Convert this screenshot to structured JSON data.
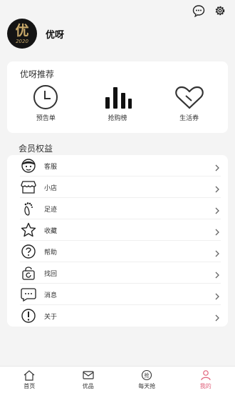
{
  "profile": {
    "avatar_glyph": "优",
    "avatar_year": "2020",
    "username": "优呀"
  },
  "recommend": {
    "title": "优呀推荐",
    "items": [
      {
        "label": "预告单",
        "icon": "clock-icon"
      },
      {
        "label": "抢购榜",
        "icon": "bar-chart-icon"
      },
      {
        "label": "生活券",
        "icon": "heart-coupon-icon"
      }
    ]
  },
  "benefits": {
    "title": "会员权益",
    "items": [
      {
        "label": "客服",
        "icon": "customer-service-icon"
      },
      {
        "label": "小店",
        "icon": "shop-icon"
      },
      {
        "label": "足迹",
        "icon": "footprint-icon"
      },
      {
        "label": "收藏",
        "icon": "star-icon"
      },
      {
        "label": "帮助",
        "icon": "help-icon"
      },
      {
        "label": "找回",
        "icon": "retrieve-icon"
      },
      {
        "label": "消息",
        "icon": "message-icon"
      },
      {
        "label": "关于",
        "icon": "info-icon"
      }
    ]
  },
  "tabbar": {
    "items": [
      {
        "label": "首页",
        "icon": "home-icon"
      },
      {
        "label": "优品",
        "icon": "mail-icon"
      },
      {
        "label": "每天抢",
        "icon": "grab-icon"
      },
      {
        "label": "我的",
        "icon": "user-icon"
      }
    ],
    "active_index": 3,
    "active_color": "#e0607a"
  }
}
